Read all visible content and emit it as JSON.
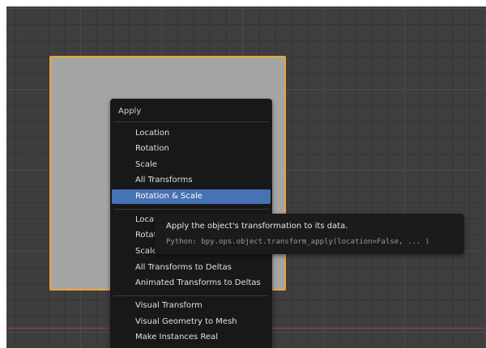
{
  "menu": {
    "title": "Apply",
    "group1": [
      "Location",
      "Rotation",
      "Scale",
      "All Transforms",
      "Rotation & Scale"
    ],
    "group2": [
      "Location to Deltas",
      "Rotation to Deltas",
      "Scale to Deltas",
      "All Transforms to Deltas",
      "Animated Transforms to Deltas"
    ],
    "group3": [
      "Visual Transform",
      "Visual Geometry to Mesh",
      "Make Instances Real"
    ],
    "highlighted": "Rotation & Scale"
  },
  "tooltip": {
    "description": "Apply the object's transformation to its data.",
    "python": "Python: bpy.ops.object.transform_apply(location=False, ... )"
  },
  "colors": {
    "viewport_bg": "#3e3e3e",
    "selection_outline": "#f0a23a",
    "highlight": "#4772b3",
    "x_axis": "#a33c42"
  }
}
